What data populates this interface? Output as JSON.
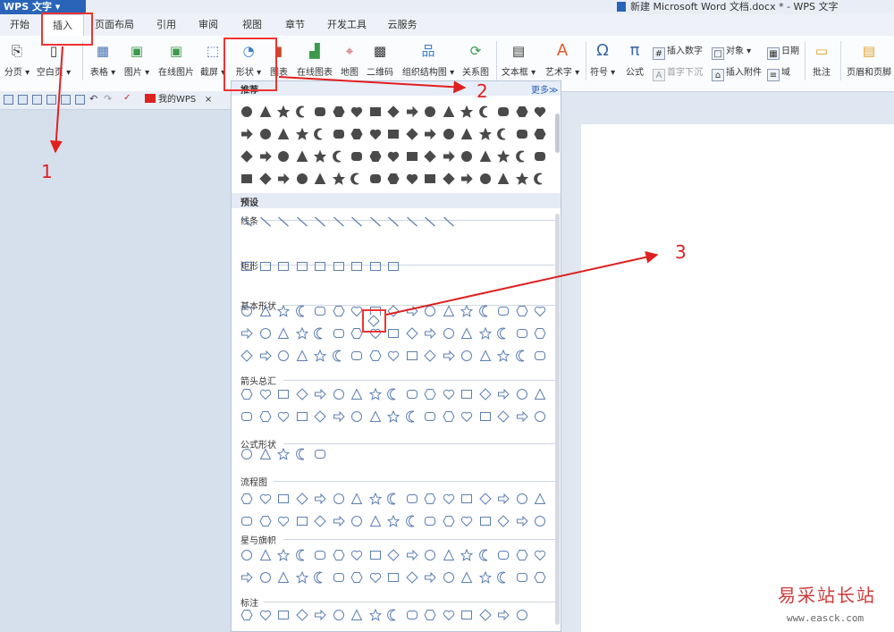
{
  "app": {
    "menu_label": "WPS 文字",
    "document_title": "新建 Microsoft Word 文档.docx * - WPS 文字"
  },
  "tabs": [
    "开始",
    "插入",
    "页面布局",
    "引用",
    "审阅",
    "视图",
    "章节",
    "开发工具",
    "云服务"
  ],
  "active_tab": "插入",
  "ribbon": {
    "buttons": [
      "分页",
      "空白页",
      "表格",
      "图片",
      "在线图片",
      "截屏",
      "形状",
      "图表",
      "在线图表",
      "地图",
      "二维码",
      "组织结构图",
      "关系图",
      "文本框",
      "艺术字",
      "符号",
      "公式",
      "批注",
      "页眉和页脚"
    ],
    "small": [
      "插入数字",
      "对象",
      "日期",
      "首字下沉",
      "插入附件",
      "域"
    ]
  },
  "quick_access": {
    "doc_tab_label": "我的WPS",
    "close": "×"
  },
  "shapes_panel": {
    "recommended_label": "推荐",
    "more_label": "更多≫",
    "presets_label": "预设",
    "sections": [
      "线条",
      "矩形",
      "基本形状",
      "箭头总汇",
      "公式形状",
      "流程图",
      "星与旗帜",
      "标注"
    ]
  },
  "annotations": {
    "step1": "1",
    "step2": "2",
    "step3": "3"
  },
  "watermark": {
    "cn": "易采站长站",
    "url": "www.easck.com"
  },
  "colors": {
    "accent": "#2a64b8",
    "highlight": "#e33333",
    "shape_fill": "#4a4a4a",
    "shape_outline": "#5b7fb2"
  }
}
